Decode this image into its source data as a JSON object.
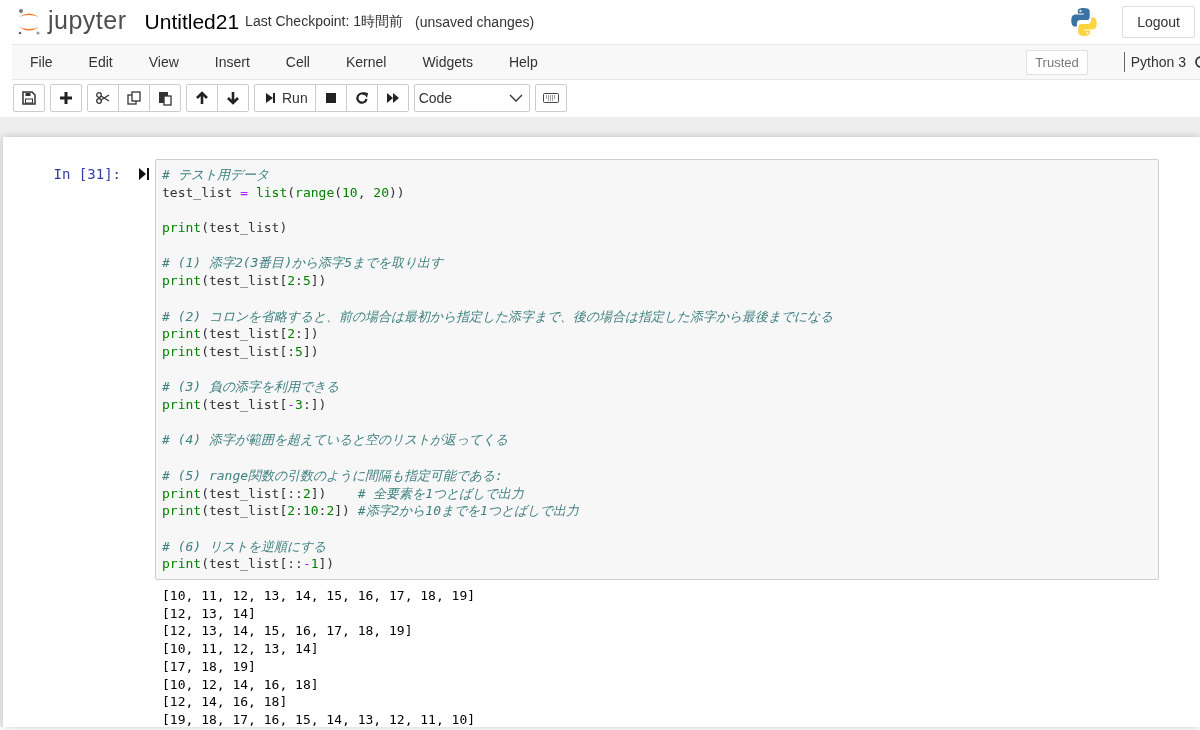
{
  "header": {
    "logo_text": "jupyter",
    "notebook_name": "Untitled21",
    "checkpoint": "Last Checkpoint: 1時間前",
    "save_status": "(unsaved changes)",
    "logout": "Logout"
  },
  "menu": [
    "File",
    "Edit",
    "View",
    "Insert",
    "Cell",
    "Kernel",
    "Widgets",
    "Help"
  ],
  "trusted": "Trusted",
  "kernel": {
    "name": "Python 3",
    "busy": false
  },
  "toolbar": [
    [
      {
        "kind": "save"
      }
    ],
    [
      {
        "kind": "plus"
      }
    ],
    [
      {
        "kind": "cut"
      },
      {
        "kind": "copy"
      },
      {
        "kind": "paste"
      }
    ],
    [
      {
        "kind": "up"
      },
      {
        "kind": "down"
      }
    ],
    [
      {
        "kind": "run",
        "label": "Run"
      },
      {
        "kind": "stop"
      },
      {
        "kind": "restart"
      },
      {
        "kind": "forward"
      }
    ],
    [
      {
        "kind": "select",
        "label": "Code"
      }
    ],
    [
      {
        "kind": "keyboard"
      }
    ]
  ],
  "cell": {
    "prompt": "In [31]:",
    "lines": [
      {
        "blank_before": false,
        "tokens": [
          {
            "kind": "comment",
            "text": "# テスト用データ"
          }
        ]
      },
      {
        "blank_before": false,
        "tokens": [
          {
            "kind": "name",
            "text": "test_list"
          },
          {
            "kind": "operator",
            "text": " = "
          },
          {
            "kind": "builtin",
            "text": "list"
          },
          {
            "kind": "name",
            "text": "("
          },
          {
            "kind": "builtin",
            "text": "range"
          },
          {
            "kind": "name",
            "text": "("
          },
          {
            "kind": "number",
            "text": "10"
          },
          {
            "kind": "name",
            "text": ", "
          },
          {
            "kind": "number",
            "text": "20"
          },
          {
            "kind": "name",
            "text": "))"
          }
        ]
      },
      {
        "blank_before": true,
        "tokens": [
          {
            "kind": "builtin",
            "text": "print"
          },
          {
            "kind": "name",
            "text": "(test_list)"
          }
        ]
      },
      {
        "blank_before": true,
        "tokens": [
          {
            "kind": "comment",
            "text": "# (1) 添字2(3番目)から添字5までを取り出す"
          }
        ]
      },
      {
        "blank_before": false,
        "tokens": [
          {
            "kind": "builtin",
            "text": "print"
          },
          {
            "kind": "name",
            "text": "(test_list["
          },
          {
            "kind": "number",
            "text": "2"
          },
          {
            "kind": "name",
            "text": ":"
          },
          {
            "kind": "number",
            "text": "5"
          },
          {
            "kind": "name",
            "text": "])"
          }
        ]
      },
      {
        "blank_before": true,
        "tokens": [
          {
            "kind": "comment",
            "text": "# (2) コロンを省略すると、前の場合は最初から指定した添字まで、後の場合は指定した添字から最後までになる"
          }
        ]
      },
      {
        "blank_before": false,
        "tokens": [
          {
            "kind": "builtin",
            "text": "print"
          },
          {
            "kind": "name",
            "text": "(test_list["
          },
          {
            "kind": "number",
            "text": "2"
          },
          {
            "kind": "name",
            "text": ":])"
          }
        ]
      },
      {
        "blank_before": false,
        "tokens": [
          {
            "kind": "builtin",
            "text": "print"
          },
          {
            "kind": "name",
            "text": "(test_list[:"
          },
          {
            "kind": "number",
            "text": "5"
          },
          {
            "kind": "name",
            "text": "])"
          }
        ]
      },
      {
        "blank_before": true,
        "tokens": [
          {
            "kind": "comment",
            "text": "# (3) 負の添字を利用できる"
          }
        ]
      },
      {
        "blank_before": false,
        "tokens": [
          {
            "kind": "builtin",
            "text": "print"
          },
          {
            "kind": "name",
            "text": "(test_list["
          },
          {
            "kind": "operator",
            "text": "-"
          },
          {
            "kind": "number",
            "text": "3"
          },
          {
            "kind": "name",
            "text": ":])"
          }
        ]
      },
      {
        "blank_before": true,
        "tokens": [
          {
            "kind": "comment",
            "text": "# (4) 添字が範囲を超えていると空のリストが返ってくる"
          }
        ]
      },
      {
        "blank_before": true,
        "tokens": [
          {
            "kind": "comment",
            "text": "# (5) range関数の引数のように間隔も指定可能である:"
          }
        ]
      },
      {
        "blank_before": false,
        "tokens": [
          {
            "kind": "builtin",
            "text": "print"
          },
          {
            "kind": "name",
            "text": "(test_list[::"
          },
          {
            "kind": "number",
            "text": "2"
          },
          {
            "kind": "name",
            "text": "])    "
          },
          {
            "kind": "comment",
            "text": "# 全要素を1つとばしで出力"
          }
        ]
      },
      {
        "blank_before": false,
        "tokens": [
          {
            "kind": "builtin",
            "text": "print"
          },
          {
            "kind": "name",
            "text": "(test_list["
          },
          {
            "kind": "number",
            "text": "2"
          },
          {
            "kind": "name",
            "text": ":"
          },
          {
            "kind": "number",
            "text": "10"
          },
          {
            "kind": "name",
            "text": ":"
          },
          {
            "kind": "number",
            "text": "2"
          },
          {
            "kind": "name",
            "text": "]) "
          },
          {
            "kind": "comment",
            "text": "#添字2から10までを1つとばしで出力"
          }
        ]
      },
      {
        "blank_before": true,
        "tokens": [
          {
            "kind": "comment",
            "text": "# (6) リストを逆順にする"
          }
        ]
      },
      {
        "blank_before": false,
        "tokens": [
          {
            "kind": "builtin",
            "text": "print"
          },
          {
            "kind": "name",
            "text": "(test_list[::"
          },
          {
            "kind": "operator",
            "text": "-"
          },
          {
            "kind": "number",
            "text": "1"
          },
          {
            "kind": "name",
            "text": "])"
          }
        ]
      }
    ],
    "output": [
      "[10, 11, 12, 13, 14, 15, 16, 17, 18, 19]",
      "[12, 13, 14]",
      "[12, 13, 14, 15, 16, 17, 18, 19]",
      "[10, 11, 12, 13, 14]",
      "[17, 18, 19]",
      "[10, 12, 14, 16, 18]",
      "[12, 14, 16, 18]",
      "[19, 18, 17, 16, 15, 14, 13, 12, 11, 10]"
    ]
  }
}
